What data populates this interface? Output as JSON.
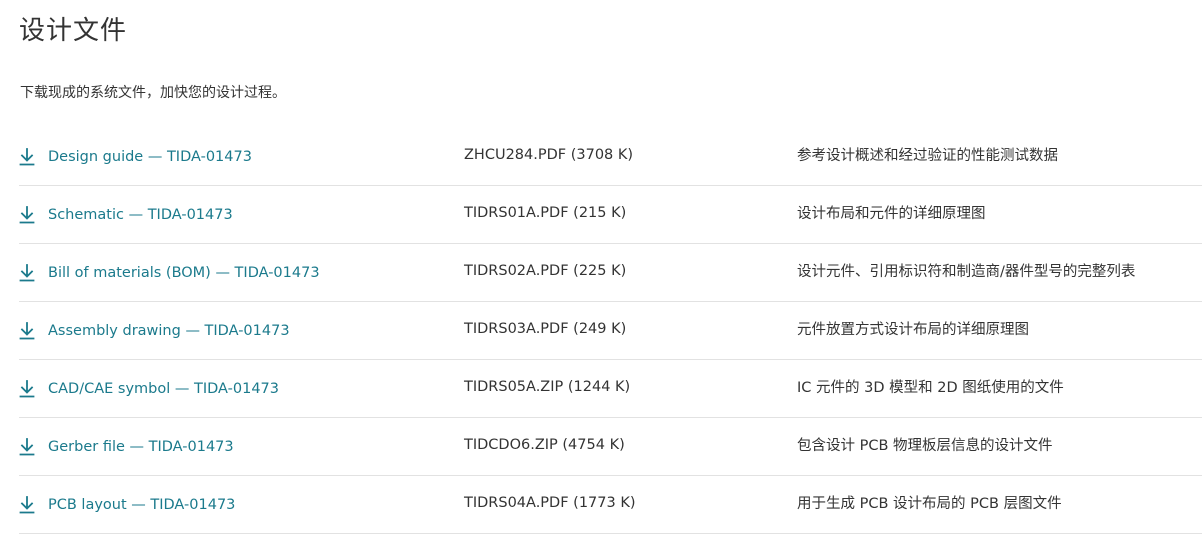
{
  "page": {
    "title": "设计文件",
    "subtitle": "下载现成的系统文件，加快您的设计过程。"
  },
  "colors": {
    "link": "#1b7a8c",
    "text": "#333333",
    "divider": "#e2e2e2"
  },
  "files": [
    {
      "icon": "download-icon",
      "link_label": "Design guide — TIDA-01473",
      "file_name": "ZHCU284.PDF (3708 K)",
      "description": "参考设计概述和经过验证的性能测试数据"
    },
    {
      "icon": "download-icon",
      "link_label": "Schematic — TIDA-01473",
      "file_name": "TIDRS01A.PDF (215 K)",
      "description": "设计布局和元件的详细原理图"
    },
    {
      "icon": "download-icon",
      "link_label": "Bill of materials (BOM) — TIDA-01473",
      "file_name": "TIDRS02A.PDF (225 K)",
      "description": "设计元件、引用标识符和制造商/器件型号的完整列表"
    },
    {
      "icon": "download-icon",
      "link_label": "Assembly drawing — TIDA-01473",
      "file_name": "TIDRS03A.PDF (249 K)",
      "description": "元件放置方式设计布局的详细原理图"
    },
    {
      "icon": "download-icon",
      "link_label": "CAD/CAE symbol — TIDA-01473",
      "file_name": "TIDRS05A.ZIP (1244 K)",
      "description": "IC 元件的 3D 模型和 2D 图纸使用的文件"
    },
    {
      "icon": "download-icon",
      "link_label": "Gerber file — TIDA-01473",
      "file_name": "TIDCDO6.ZIP (4754 K)",
      "description": "包含设计 PCB 物理板层信息的设计文件"
    },
    {
      "icon": "download-icon",
      "link_label": "PCB layout — TIDA-01473",
      "file_name": "TIDRS04A.PDF (1773 K)",
      "description": "用于生成 PCB 设计布局的 PCB 层图文件"
    }
  ]
}
